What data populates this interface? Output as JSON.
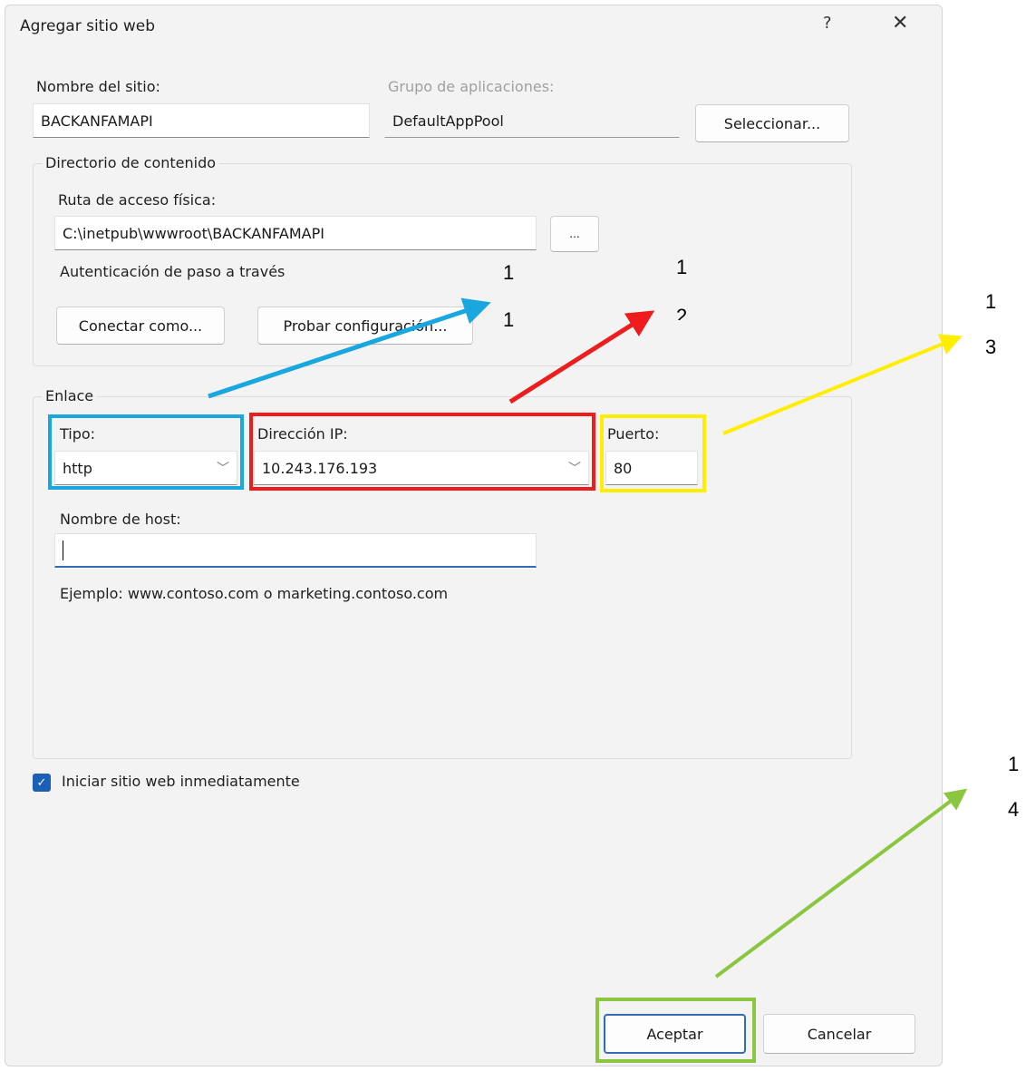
{
  "dialog": {
    "title": "Agregar sitio web",
    "help_label": "?",
    "close_label": "✕"
  },
  "site": {
    "name_label": "Nombre del sitio:",
    "name_value": "BACKANFAMAPI",
    "pool_label": "Grupo de aplicaciones:",
    "pool_value": "DefaultAppPool",
    "select_button": "Seleccionar..."
  },
  "content_dir": {
    "legend": "Directorio de contenido",
    "path_label": "Ruta de acceso física:",
    "path_value": "C:\\inetpub\\wwwroot\\BACKANFAMAPI",
    "browse_button": "...",
    "passthrough_label": "Autenticación de paso a través",
    "connect_button": "Conectar como...",
    "test_button": "Probar configuración..."
  },
  "binding": {
    "legend": "Enlace",
    "type_label": "Tipo:",
    "type_value": "http",
    "ip_label": "Dirección IP:",
    "ip_value": "10.243.176.193",
    "port_label": "Puerto:",
    "port_value": "80",
    "host_label": "Nombre de host:",
    "host_value": "",
    "example_text": "Ejemplo: www.contoso.com o marketing.contoso.com"
  },
  "start_checkbox": {
    "label": "Iniciar sitio web inmediatamente",
    "checked": true
  },
  "footer": {
    "ok_button": "Aceptar",
    "cancel_button": "Cancelar"
  },
  "annotations": [
    {
      "top": "1",
      "bottom": "1",
      "color": "#1aa7e0"
    },
    {
      "top": "1",
      "bottom": "2",
      "color": "#ee1c1c"
    },
    {
      "top": "1",
      "bottom": "3",
      "color": "#ffee00"
    },
    {
      "top": "1",
      "bottom": "4",
      "color": "#8cc63f"
    }
  ],
  "icons": {
    "chevron": "chevron-down-icon",
    "check": "checkmark-icon"
  }
}
